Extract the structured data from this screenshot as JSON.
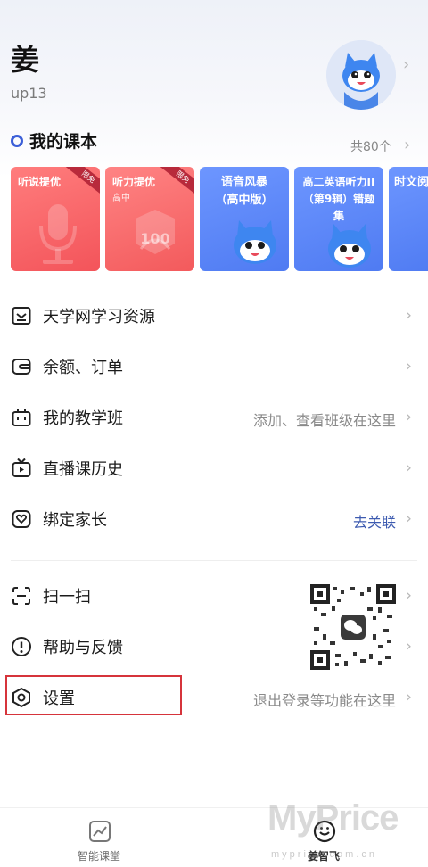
{
  "profile": {
    "name": "姜",
    "id": "up13"
  },
  "textbooks": {
    "title": "我的课本",
    "count": "共80个",
    "items": [
      {
        "title": "听说提优",
        "subtitle": "",
        "badge": "限免",
        "color": "#f55b5e"
      },
      {
        "title": "听力提优",
        "subtitle": "高中",
        "badge": "限免",
        "color": "#f55b5e"
      },
      {
        "title": "语音风暴\n（高中版）",
        "subtitle": "",
        "badge": "",
        "color": "#5b87f7"
      },
      {
        "title": "高二英语听力II（第9辑）错题集",
        "subtitle": "",
        "badge": "",
        "color": "#5b87f7"
      },
      {
        "title": "时文阅",
        "subtitle": "",
        "badge": "",
        "color": "#5b87f7"
      }
    ]
  },
  "book_art": {
    "score": "100"
  },
  "menu": [
    {
      "label": "天学网学习资源",
      "hint": "",
      "icon": "resource-icon"
    },
    {
      "label": "余额、订单",
      "hint": "",
      "icon": "wallet-icon"
    },
    {
      "label": "我的教学班",
      "hint": "添加、查看班级在这里",
      "icon": "class-icon"
    },
    {
      "label": "直播课历史",
      "hint": "",
      "icon": "live-icon"
    },
    {
      "label": "绑定家长",
      "hint": "去关联",
      "icon": "parent-icon"
    },
    {
      "label": "扫一扫",
      "hint": "",
      "icon": "scan-icon"
    },
    {
      "label": "帮助与反馈",
      "hint": "",
      "icon": "help-icon"
    },
    {
      "label": "设置",
      "hint": "退出登录等功能在这里",
      "icon": "settings-icon"
    }
  ],
  "bottom_nav": [
    {
      "label": "智能课堂",
      "icon": "chart-icon",
      "active": false
    },
    {
      "label": "姜智飞",
      "icon": "profile-tab-icon",
      "active": true
    }
  ],
  "watermark": {
    "main": "MyPrice",
    "sub": "myprice.com.cn"
  },
  "colors": {
    "accent": "#3c5fd8",
    "link": "#3d5bb0",
    "highlight": "#d6343b",
    "book_red": "#f55b5e",
    "book_blue": "#5b87f7"
  }
}
